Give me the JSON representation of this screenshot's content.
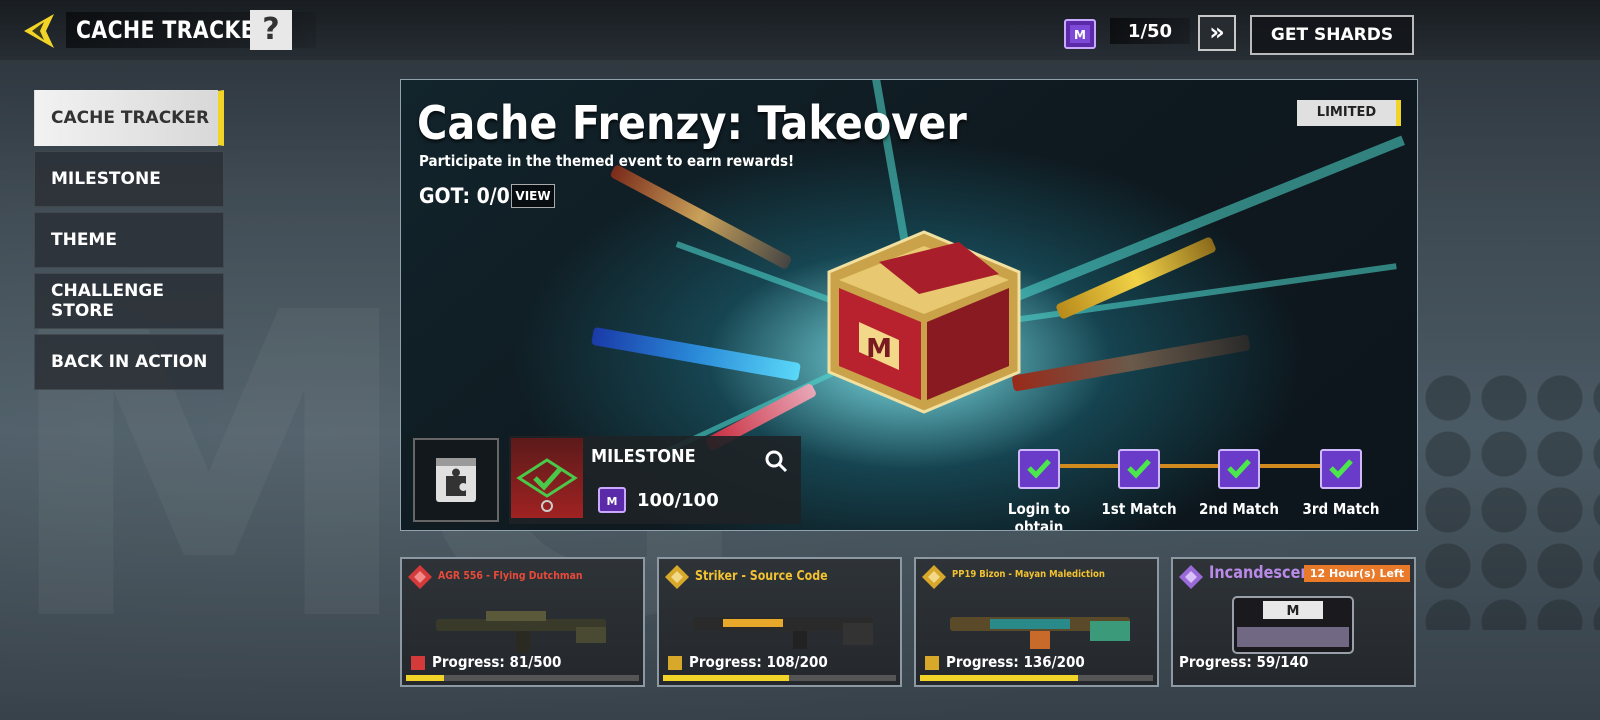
{
  "header": {
    "title": "CACHE TRACKER",
    "help": "?"
  },
  "currency": {
    "count": "1/50",
    "next": "»",
    "get_shards_label": "GET SHARDS"
  },
  "sidebar": {
    "items": [
      {
        "label": "CACHE TRACKER",
        "active": true
      },
      {
        "label": "MILESTONE",
        "active": false
      },
      {
        "label": "THEME",
        "active": false
      },
      {
        "label": "CHALLENGE STORE",
        "active": false
      },
      {
        "label": "BACK IN ACTION",
        "active": false
      }
    ]
  },
  "banner": {
    "title": "Cache Frenzy: Takeover",
    "subtitle": "Participate in the themed event to earn rewards!",
    "got": "GOT: 0/0",
    "view_label": "VIEW",
    "tag": "LIMITED"
  },
  "milestone": {
    "label": "MILESTONE",
    "count": "100/100"
  },
  "track": {
    "steps": [
      {
        "label": "Login to obtain",
        "completed": true
      },
      {
        "label": "1st Match",
        "completed": true
      },
      {
        "label": "2nd Match",
        "completed": true
      },
      {
        "label": "3rd Match",
        "completed": true
      }
    ]
  },
  "cards": [
    {
      "name": "AGR 556 - Flying Dutchman",
      "name_color": "#e84a3a",
      "progress": "Progress: 81/500",
      "fraction": 0.162,
      "badge_color": "#d43a3a"
    },
    {
      "name": "Striker - Source Code",
      "name_color": "#f2c230",
      "progress": "Progress: 108/200",
      "fraction": 0.54,
      "badge_color": "#d8a82a"
    },
    {
      "name": "PP19 Bizon - Mayan Malediction",
      "name_color": "#f2c230",
      "progress": "Progress: 136/200",
      "fraction": 0.68,
      "badge_color": "#d8a82a"
    },
    {
      "name": "Incandescent",
      "name_color": "#b98ae8",
      "progress": "Progress: 59/140",
      "fraction": 0.42,
      "badge_color": "#9a6ad8",
      "timer": "12 Hour(s) Left"
    }
  ],
  "colors": {
    "accent": "#f2d327",
    "panel": "#2d3238",
    "track": "#d08a1e"
  }
}
